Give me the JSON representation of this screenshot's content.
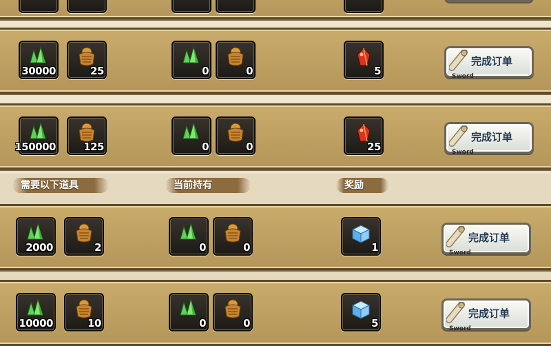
{
  "headers": {
    "required": "需要以下道具",
    "current": "当前持有",
    "reward": "奖励"
  },
  "button_label": "完成订单",
  "button_brand": "Sword",
  "icons": {
    "item1": "green-crystal-icon",
    "item2": "golden-armor-icon",
    "reward_red": "red-gem-icon",
    "reward_blue": "blue-cube-icon",
    "button": "scroll-icon"
  },
  "colors": {
    "panel_gold": "#c9ab6c",
    "slot_dark": "#2a2622",
    "button_text": "#22384f"
  },
  "orders": [
    {
      "required": [
        "30000",
        "25"
      ],
      "held": [
        "0",
        "0"
      ],
      "reward": {
        "type": "red",
        "qty": "5"
      }
    },
    {
      "required": [
        "150000",
        "125"
      ],
      "held": [
        "0",
        "0"
      ],
      "reward": {
        "type": "red",
        "qty": "25"
      }
    },
    {
      "required": [
        "2000",
        "2"
      ],
      "held": [
        "0",
        "0"
      ],
      "reward": {
        "type": "blue",
        "qty": "1"
      }
    },
    {
      "required": [
        "10000",
        "10"
      ],
      "held": [
        "0",
        "0"
      ],
      "reward": {
        "type": "blue",
        "qty": "5"
      }
    }
  ]
}
